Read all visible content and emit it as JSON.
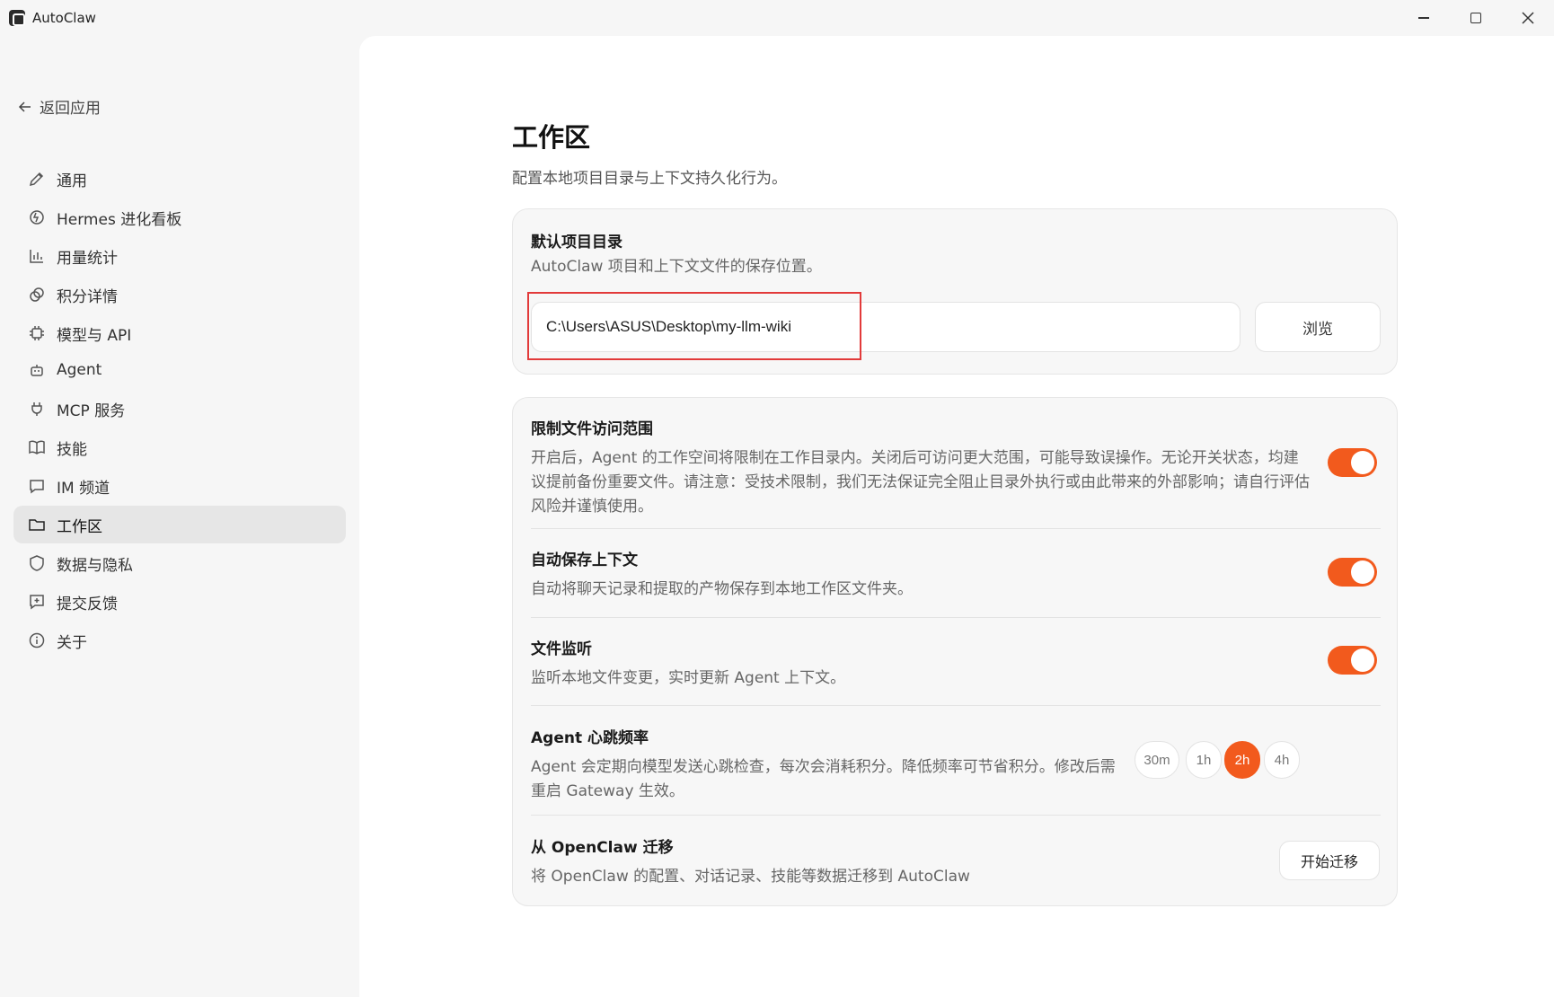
{
  "window": {
    "title": "AutoClaw",
    "min_icon": "minimize-icon",
    "max_icon": "maximize-icon",
    "close_icon": "close-icon"
  },
  "sidebar": {
    "back_label": "返回应用",
    "items": [
      {
        "label": "通用",
        "icon": "pen-icon"
      },
      {
        "label": "Hermes 进化看板",
        "icon": "evolution-icon"
      },
      {
        "label": "用量统计",
        "icon": "bar-chart-icon"
      },
      {
        "label": "积分详情",
        "icon": "coins-icon"
      },
      {
        "label": "模型与 API",
        "icon": "chip-icon"
      },
      {
        "label": "Agent",
        "icon": "robot-icon"
      },
      {
        "label": "MCP 服务",
        "icon": "plug-icon"
      },
      {
        "label": "技能",
        "icon": "book-icon"
      },
      {
        "label": "IM 频道",
        "icon": "chat-icon"
      },
      {
        "label": "工作区",
        "icon": "folder-icon",
        "active": true
      },
      {
        "label": "数据与隐私",
        "icon": "shield-icon"
      },
      {
        "label": "提交反馈",
        "icon": "feedback-icon"
      },
      {
        "label": "关于",
        "icon": "info-icon"
      }
    ]
  },
  "main": {
    "title": "工作区",
    "subtitle": "配置本地项目目录与上下文持久化行为。",
    "default_dir": {
      "title": "默认项目目录",
      "desc": "AutoClaw 项目和上下文文件的保存位置。",
      "path_value": "C:\\Users\\ASUS\\Desktop\\my-llm-wiki",
      "browse_label": "浏览"
    },
    "restrict_access": {
      "title": "限制文件访问范围",
      "desc": "开启后，Agent 的工作空间将限制在工作目录内。关闭后可访问更大范围，可能导致误操作。无论开关状态，均建议提前备份重要文件。请注意：受技术限制，我们无法保证完全阻止目录外执行或由此带来的外部影响；请自行评估风险并谨慎使用。",
      "enabled": true
    },
    "auto_save": {
      "title": "自动保存上下文",
      "desc": "自动将聊天记录和提取的产物保存到本地工作区文件夹。",
      "enabled": true
    },
    "file_watch": {
      "title": "文件监听",
      "desc": "监听本地文件变更，实时更新 Agent 上下文。",
      "enabled": true
    },
    "heartbeat": {
      "title": "Agent 心跳频率",
      "desc": "Agent 会定期向模型发送心跳检查，每次会消耗积分。降低频率可节省积分。修改后需重启 Gateway 生效。",
      "options": [
        "30m",
        "1h",
        "2h",
        "4h"
      ],
      "selected": "2h"
    },
    "migrate": {
      "title": "从 OpenClaw 迁移",
      "desc": "将 OpenClaw 的配置、对话记录、技能等数据迁移到 AutoClaw",
      "button_label": "开始迁移"
    }
  },
  "colors": {
    "accent": "#f25a1d",
    "highlight_border": "#e23a3a"
  }
}
